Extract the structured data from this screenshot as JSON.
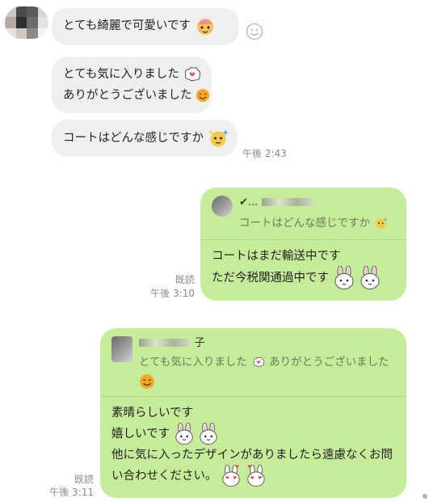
{
  "incoming": [
    {
      "text": "とても綺麗で可愛いです",
      "emoji": "blushing-face-icon"
    },
    {
      "lines": [
        "とても気に入りました",
        "ありがとうございました"
      ]
    },
    {
      "text": "コートはどんな感じですか",
      "emoji": "sparkle-face-icon"
    }
  ],
  "incoming_time": "午後 2:43",
  "reply1": {
    "quote_name": "✔...",
    "quote_text": "コートはどんな感じですか",
    "lines": [
      "コートはまだ輸送中です",
      "ただ今税関通過中です"
    ],
    "read": "既読",
    "time": "午後 3:10"
  },
  "reply2": {
    "quote_name": "子",
    "quote_text": "とても気に入りました",
    "quote_text2": "ありがとうございました",
    "lines": [
      "素晴らしいです",
      "嬉しいです",
      "他に気に入ったデザインがありましたら遠慮なくお問",
      "い合わせください。"
    ],
    "read": "既読",
    "time": "午後 3:11"
  },
  "colors": {
    "green_bubble": "#c7ec99",
    "grey_bubble": "#efefef",
    "meta": "#8b8b8b"
  }
}
